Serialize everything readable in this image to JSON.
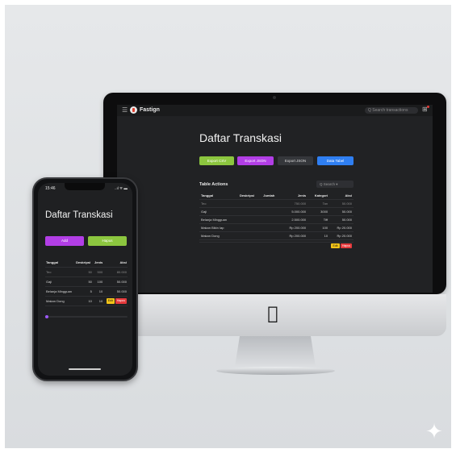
{
  "desktop": {
    "brand": "Fastign",
    "search_placeholder": "Q  Search transactions",
    "page_title": "Daftar Transkasi",
    "buttons": {
      "export_csv": "Export CSV",
      "export_json": "Export JSON",
      "export_json_alt": "Export JSON",
      "upload": "Data Tabel"
    },
    "table_title": "Table Actions",
    "filter_label": "Q  Search ▾",
    "columns": [
      "Tanggal",
      "Deskripsi",
      "Jumlah",
      "Jenis",
      "Kategori",
      "Aksi"
    ],
    "rows": [
      [
        "Teo",
        "",
        "",
        "750.000",
        "Tan",
        "50.000"
      ],
      [
        "Gaji",
        "",
        "",
        "5.000.000",
        "3000",
        "50.000"
      ],
      [
        "Belanja Mingguan",
        "",
        "",
        "2.500.000",
        "Tiff",
        "50.000"
      ],
      [
        "Makan Bikin Iap",
        "",
        "",
        "Rp 200.000",
        "100",
        "Rp 20.000"
      ],
      [
        "Makan Dong",
        "",
        "",
        "Rp 200.000",
        "10",
        "Rp 20.000"
      ]
    ],
    "actions": {
      "edit": "Edit",
      "delete": "Hapus"
    }
  },
  "phone": {
    "time": "15:46",
    "status": "..ıl ᯤ ▬",
    "page_title": "Daftar Transkasi",
    "add_label": "Add",
    "export_label": "Hapus",
    "columns": [
      "Tanggal",
      "Deskripsi",
      "Jenis",
      "Aksi"
    ],
    "rows": [
      [
        "Teo",
        "50",
        "500",
        "80.000"
      ],
      [
        "Gaji",
        "50",
        "100",
        "50.000"
      ],
      [
        "Belanja Mingguan",
        "5",
        "10",
        "50.000"
      ],
      [
        "Makan Dong",
        "10",
        "10",
        ""
      ]
    ],
    "actions": {
      "edit": "Edit",
      "delete": "Hapus"
    }
  },
  "icons": {
    "menu": "menu-icon",
    "brand": "brand-logo-icon",
    "grid": "grid-icon",
    "apple": "apple-logo-icon",
    "sparkle": "sparkle-icon"
  }
}
